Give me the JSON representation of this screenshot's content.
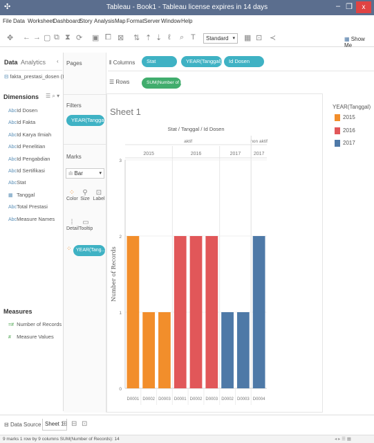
{
  "window": {
    "title": "Tableau - Book1 - Tableau license expires in 14 days"
  },
  "menu": [
    "File",
    "Data",
    "Worksheet",
    "Dashboard",
    "Story",
    "Analysis",
    "Map",
    "Format",
    "Server",
    "Window",
    "Help"
  ],
  "toolbar": {
    "fit_value": "Standard",
    "show_me": "Show Me"
  },
  "datapane": {
    "tabs": [
      "Data",
      "Analytics"
    ],
    "source": "fakta_prestasi_dosen (I)...",
    "dimensions_title": "Dimensions",
    "dimensions": [
      "Id Dosen",
      "Id Fakta",
      "Id Karya Ilmiah",
      "Id Penelitian",
      "Id Pengabdian",
      "Id Sertifikasi",
      "Stat",
      "Tanggal",
      "Total Prestasi",
      "Measure Names"
    ],
    "measures_title": "Measures",
    "measures": [
      "Number of Records",
      "Measure Values"
    ]
  },
  "shelves": {
    "pages_label": "Pages",
    "filters_label": "Filters",
    "filters": [
      "YEAR(Tanggal)"
    ],
    "marks_label": "Marks",
    "mark_type": "Bar",
    "mark_buttons": [
      "Color",
      "Size",
      "Label",
      "Detail",
      "Tooltip"
    ],
    "color_field": "YEAR(Tang...",
    "columns_label": "Columns",
    "columns": [
      "Stat",
      "YEAR(Tanggal)",
      "Id Dosen"
    ],
    "rows_label": "Rows",
    "rows": [
      "SUM(Number of Rec..."
    ]
  },
  "sheet": {
    "title": "Sheet 1"
  },
  "legend": {
    "title": "YEAR(Tanggal)",
    "items": [
      {
        "label": "2015",
        "color": "#f28e2b"
      },
      {
        "label": "2016",
        "color": "#e15759"
      },
      {
        "label": "2017",
        "color": "#4e79a7"
      }
    ]
  },
  "chart_data": {
    "type": "bar",
    "header_title": "Stat / Tanggal / Id Dosen",
    "stat_groups": [
      {
        "label": "aktif",
        "span": 8
      },
      {
        "label": "non aktif",
        "span": 1
      }
    ],
    "year_groups": [
      {
        "label": "2015",
        "span": 3,
        "color": "#f28e2b"
      },
      {
        "label": "2016",
        "span": 3,
        "color": "#e15759"
      },
      {
        "label": "2017",
        "span": 2,
        "color": "#4e79a7"
      },
      {
        "label": "2017",
        "span": 1,
        "color": "#4e79a7"
      }
    ],
    "categories": [
      "D0001",
      "D0002",
      "D0003",
      "D0001",
      "D0002",
      "D0003",
      "D0002",
      "D0003",
      "D0004"
    ],
    "values": [
      2,
      1,
      1,
      2,
      2,
      2,
      1,
      1,
      2
    ],
    "colors": [
      "#f28e2b",
      "#f28e2b",
      "#f28e2b",
      "#e15759",
      "#e15759",
      "#e15759",
      "#4e79a7",
      "#4e79a7",
      "#4e79a7"
    ],
    "ylabel": "Number of Records",
    "yticks": [
      0,
      1,
      2,
      3
    ],
    "ylim": [
      0,
      3
    ],
    "grid": true
  },
  "bottom": {
    "data_source": "Data Source",
    "sheet_tab": "Sheet 1"
  },
  "status": {
    "text": "9 marks   1 row by 9 columns   SUM(Number of Records): 14"
  }
}
